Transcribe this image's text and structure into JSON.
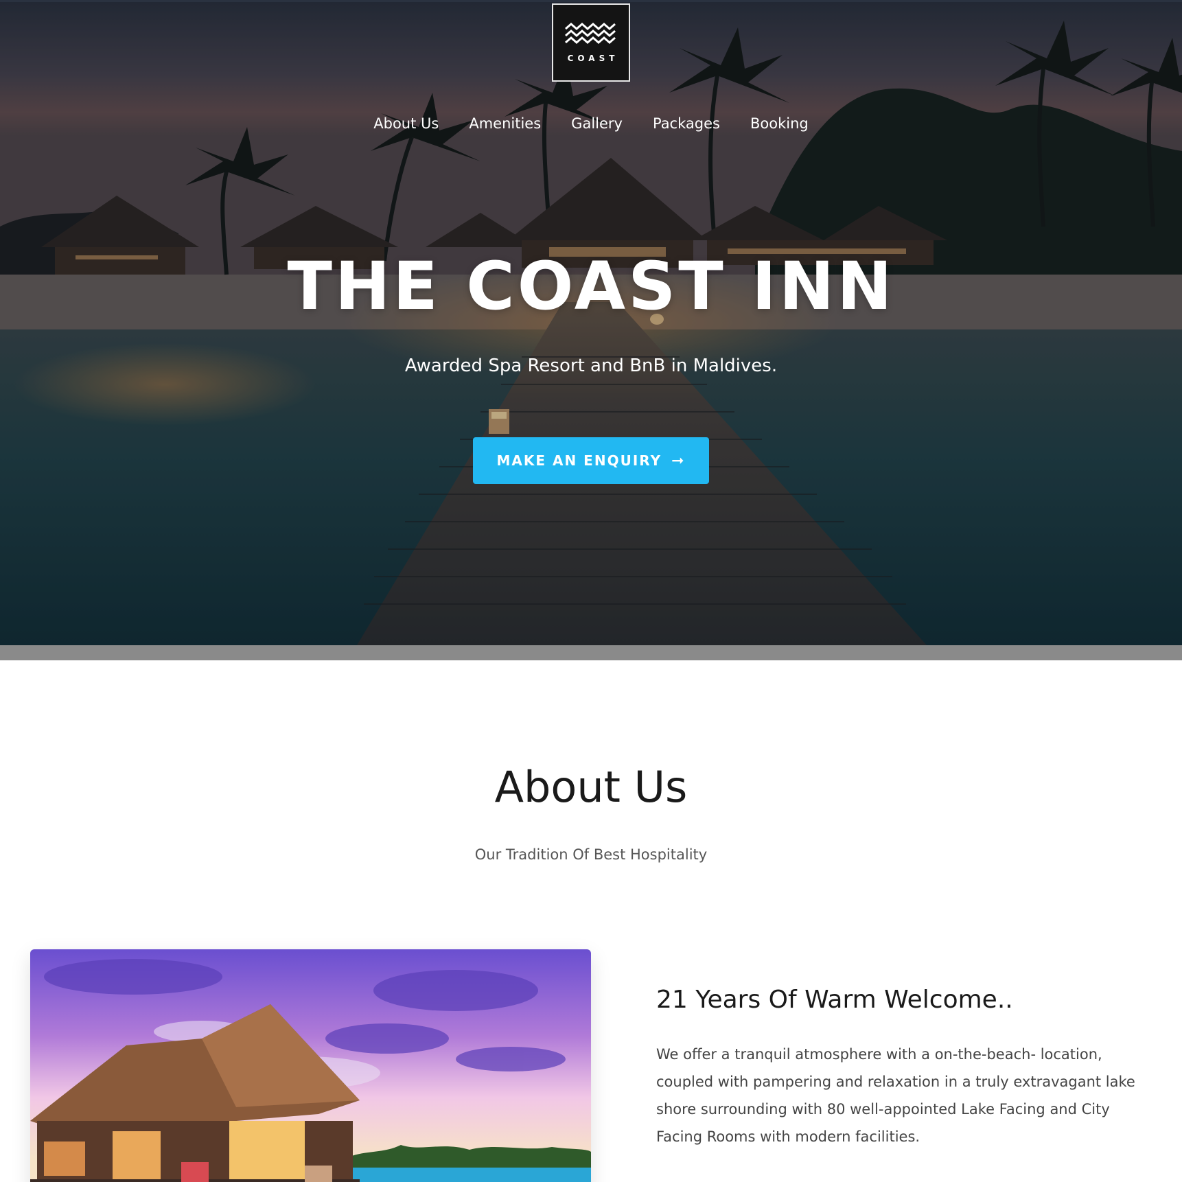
{
  "brand": {
    "logo_text": "COAST",
    "icon": "waves-icon"
  },
  "nav": {
    "items": [
      {
        "label": "About Us"
      },
      {
        "label": "Amenities"
      },
      {
        "label": "Gallery"
      },
      {
        "label": "Packages"
      },
      {
        "label": "Booking"
      }
    ]
  },
  "hero": {
    "title": "THE COAST INN",
    "subtitle": "Awarded Spa Resort and BnB in Maldives.",
    "cta_label": "MAKE AN ENQUIRY",
    "cta_icon": "arrow-right-icon",
    "cta_color": "#22b8f2"
  },
  "about": {
    "title": "About Us",
    "tagline": "Our Tradition Of Best Hospitality",
    "heading": "21 Years Of Warm Welcome..",
    "body": "We offer a tranquil atmosphere with a on-the-beach- location, coupled with pampering and relaxation in a truly extravagant lake shore surrounding with 80 well-appointed Lake Facing and City Facing Rooms with modern facilities."
  },
  "colors": {
    "accent": "#22b8f2",
    "heading_text": "#1a1a1a",
    "body_text": "#444444"
  }
}
